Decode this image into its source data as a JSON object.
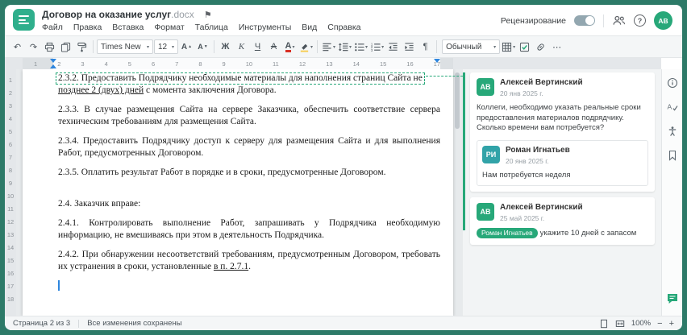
{
  "window": {
    "title": "Договор на оказание услуг",
    "ext": ".docx"
  },
  "header": {
    "menu": [
      "Файл",
      "Правка",
      "Вставка",
      "Формат",
      "Таблица",
      "Инструменты",
      "Вид",
      "Справка"
    ],
    "review_label": "Рецензирование",
    "avatar_initials": "АВ",
    "accent_color": "#27A879"
  },
  "toolbar": {
    "font_name": "Times New",
    "font_size": "12",
    "style_name": "Обычный",
    "labels": {
      "bold": "Ж",
      "italic": "К",
      "underline": "Ч",
      "strike": "А"
    },
    "items": [
      "undo",
      "redo",
      "print",
      "copy",
      "format-painter",
      "sep",
      "font-select",
      "size-select",
      "font-increase",
      "font-decrease",
      "sep",
      "bold",
      "italic",
      "underline",
      "strike",
      "font-color",
      "highlight",
      "sep",
      "align",
      "line-spacing",
      "bullet-list",
      "numbered-list",
      "outdent",
      "indent",
      "pilcrow",
      "sep",
      "style-select",
      "table",
      "checkbox",
      "link",
      "more"
    ]
  },
  "ruler": {
    "h_numbers": [
      "1",
      "2",
      "3",
      "4",
      "5",
      "6",
      "7",
      "8",
      "9",
      "10",
      "11",
      "12",
      "13",
      "14",
      "15",
      "16",
      "17"
    ],
    "v_numbers": [
      "1",
      "2",
      "3",
      "4",
      "5",
      "6",
      "7",
      "8",
      "9",
      "10",
      "11",
      "12",
      "13",
      "14",
      "15",
      "16",
      "17",
      "18"
    ]
  },
  "document": {
    "paragraphs": [
      {
        "anchored_line": "2.3.2. Предоставить Подрядчику необходимые материалы для наполнения страниц Сайта не",
        "segments": [
          {
            "text": "позднее 2 (двух) дней",
            "underline": true
          },
          {
            "text": " с момента заключения Договора.",
            "underline": false
          }
        ]
      },
      {
        "segments": [
          {
            "text": "2.3.3. В случае размещения Сайта на сервере Заказчика, обеспечить соответствие сервера техническим требованиям для размещения Сайта.",
            "underline": false
          }
        ]
      },
      {
        "segments": [
          {
            "text": "2.3.4. Предоставить Подрядчику доступ к серверу для размещения Сайта и для выполнения Работ, предусмотренных Договором.",
            "underline": false
          }
        ]
      },
      {
        "segments": [
          {
            "text": "2.3.5. Оплатить результат Работ в порядке и в сроки, предусмотренные Договором.",
            "underline": false
          }
        ]
      },
      {
        "extra_gap": true,
        "segments": [
          {
            "text": "2.4. Заказчик вправе:",
            "underline": false
          }
        ]
      },
      {
        "segments": [
          {
            "text": "2.4.1. Контролировать выполнение Работ, запрашивать у Подрядчика необходимую информацию, не вмешиваясь при этом в деятельность Подрядчика.",
            "underline": false
          }
        ]
      },
      {
        "segments": [
          {
            "text": "2.4.2. При обнаружении несоответствий требованиям, предусмотренным Договором, требовать их устранения в сроки, установленные ",
            "underline": false
          },
          {
            "text": "в п. 2.7.1",
            "underline": true
          },
          {
            "text": ".",
            "underline": false
          }
        ]
      }
    ]
  },
  "comments": {
    "threads": [
      {
        "author": "Алексей Вертинский",
        "initials": "АВ",
        "avatar_color": "#27A879",
        "date": "20 янв 2025 г.",
        "text": "Коллеги, необходимо указать реальные сроки предоставления материалов подрядчику. Сколько времени вам потребуется?",
        "replies": [
          {
            "author": "Роман Игнатьев",
            "initials": "РИ",
            "avatar_color": "#31A3A8",
            "date": "20 янв 2025 г.",
            "text": "Нам потребуется неделя"
          }
        ]
      },
      {
        "author": "Алексей Вертинский",
        "initials": "АВ",
        "avatar_color": "#27A879",
        "date": "25 май 2025 г.",
        "mention": "Роман Игнатьев",
        "text": "укажите 10 дней с запасом",
        "replies": []
      }
    ]
  },
  "right_sidebar": {
    "items": [
      "info",
      "spellcheck",
      "accessibility",
      "bookmark"
    ]
  },
  "status": {
    "page_info": "Страница 2 из 3",
    "saved": "Все изменения сохранены",
    "zoom": "100%"
  }
}
